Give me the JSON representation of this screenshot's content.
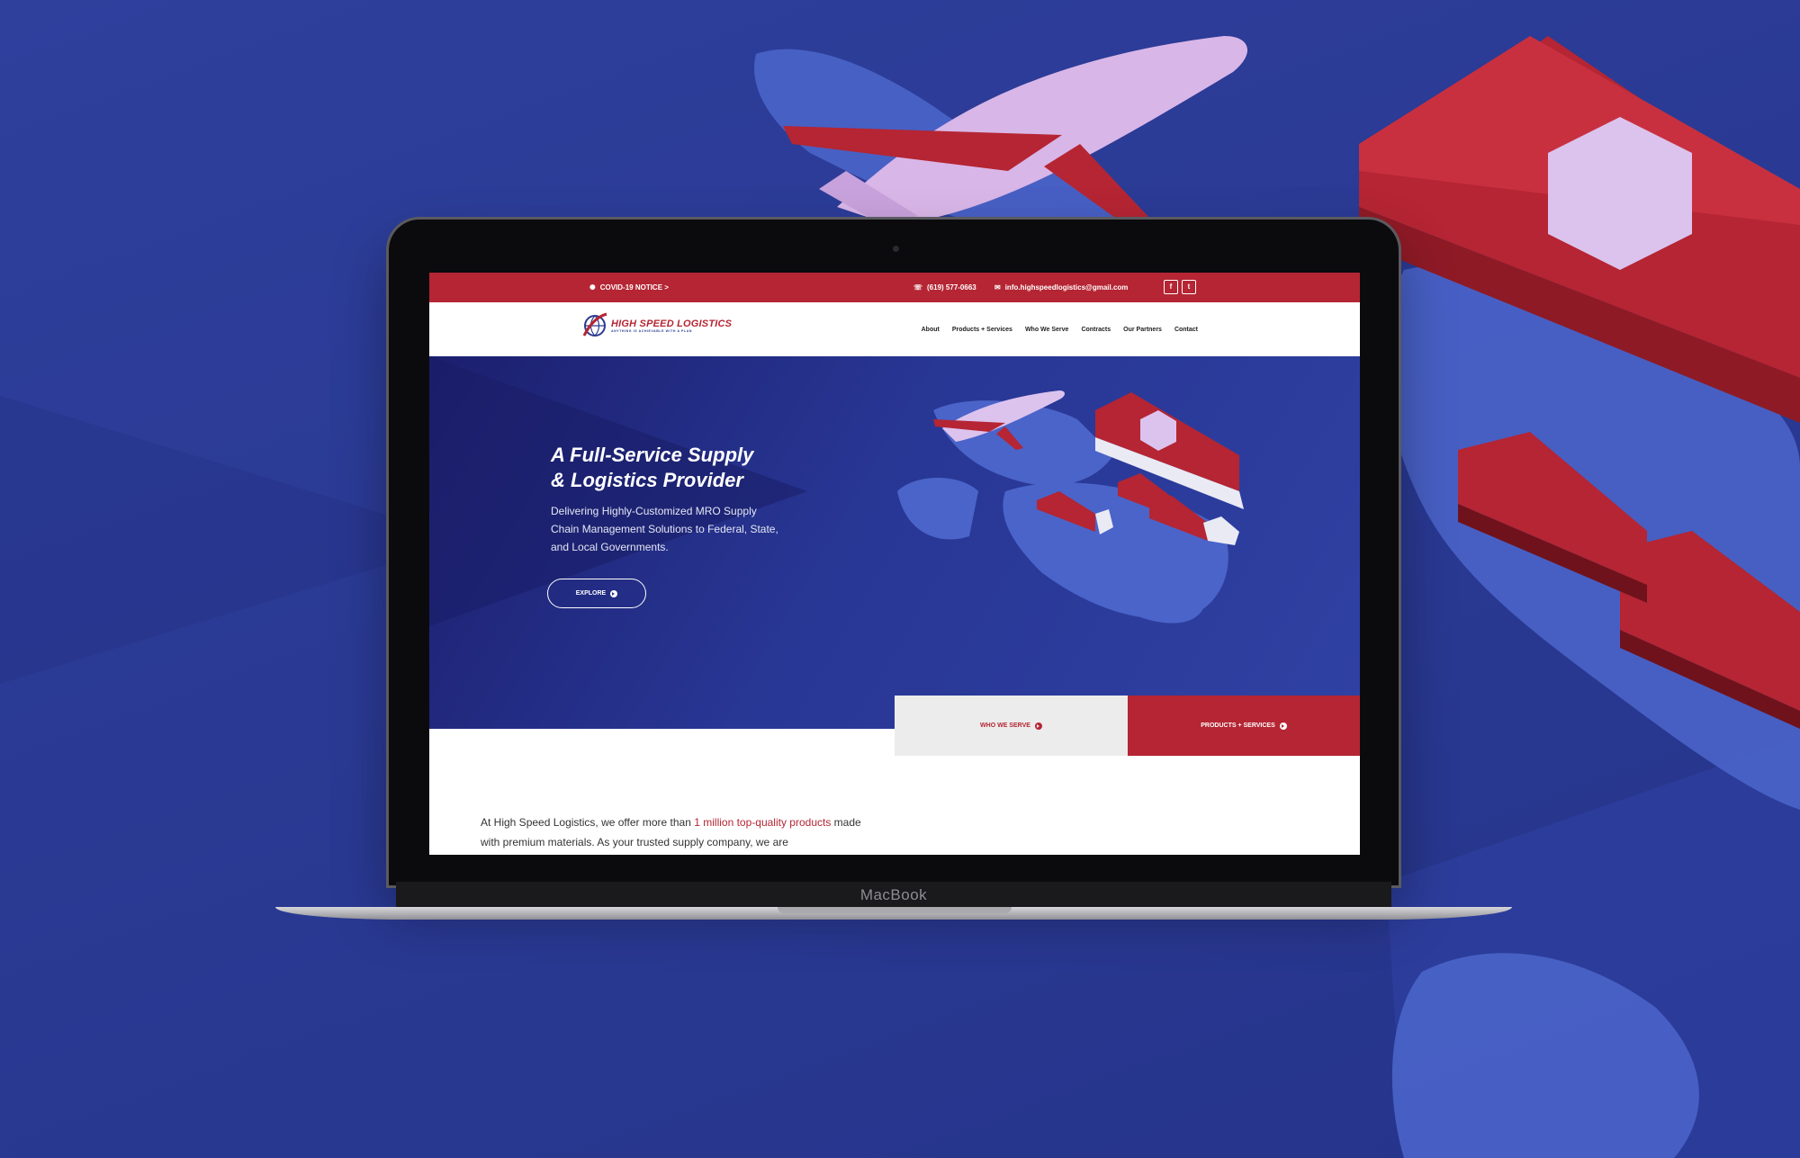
{
  "colors": {
    "brand_red": "#b52533",
    "brand_blue": "#2b3a8f",
    "background": "#2a3a94"
  },
  "device": {
    "brand_label": "MacBook"
  },
  "site": {
    "topbar": {
      "covid_notice": "COVID-19 NOTICE >",
      "phone": "(619) 577-0663",
      "email": "info.highspeedlogistics@gmail.com",
      "social": [
        "f",
        "t"
      ]
    },
    "logo": {
      "name": "HIGH SPEED LOGISTICS",
      "tagline": "ANYTHING IS ACHIEVABLE WITH A PLAN"
    },
    "nav": {
      "items": [
        "About",
        "Products + Services",
        "Who We Serve",
        "Contracts",
        "Our Partners",
        "Contact"
      ]
    },
    "hero": {
      "title_line1": "A Full-Service Supply",
      "title_line2": "& Logistics Provider",
      "subtitle": "Delivering Highly-Customized MRO Supply Chain Management Solutions to Federal, State, and Local Governments.",
      "cta": "EXPLORE"
    },
    "cta_buttons": {
      "who_we_serve": "WHO WE SERVE",
      "products_services": "PRODUCTS + SERVICES"
    },
    "about": {
      "text_before": "At High Speed Logistics, we offer more than ",
      "highlight": "1 million top-quality products",
      "text_after": " made with premium materials. As your trusted supply company, we are"
    }
  }
}
